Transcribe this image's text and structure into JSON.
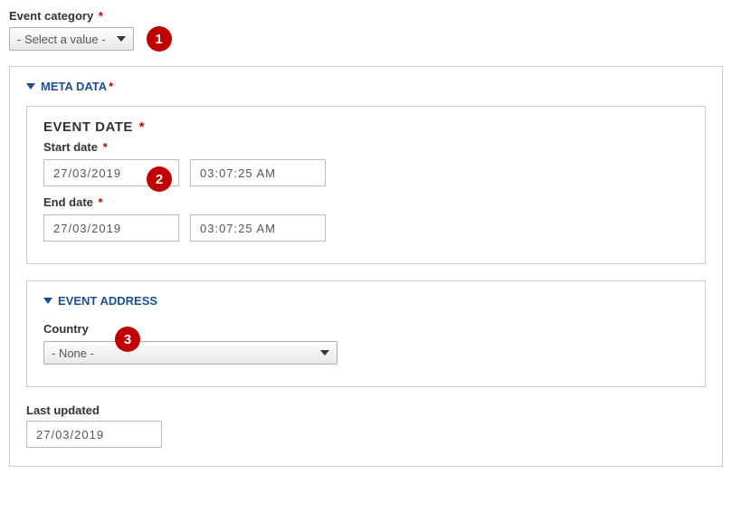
{
  "event_category": {
    "label": "Event category",
    "value": "- Select a value -"
  },
  "meta_data": {
    "title": "META DATA",
    "event_date": {
      "legend": "EVENT DATE",
      "start": {
        "label": "Start date",
        "date": "27/03/2019",
        "time": "03:07:25 AM"
      },
      "end": {
        "label": "End date",
        "date": "27/03/2019",
        "time": "03:07:25 AM"
      }
    },
    "event_address": {
      "title": "EVENT ADDRESS",
      "country": {
        "label": "Country",
        "value": "- None -"
      }
    },
    "last_updated": {
      "label": "Last updated",
      "date": "27/03/2019"
    }
  },
  "markers": {
    "m1": "1",
    "m2": "2",
    "m3": "3"
  }
}
